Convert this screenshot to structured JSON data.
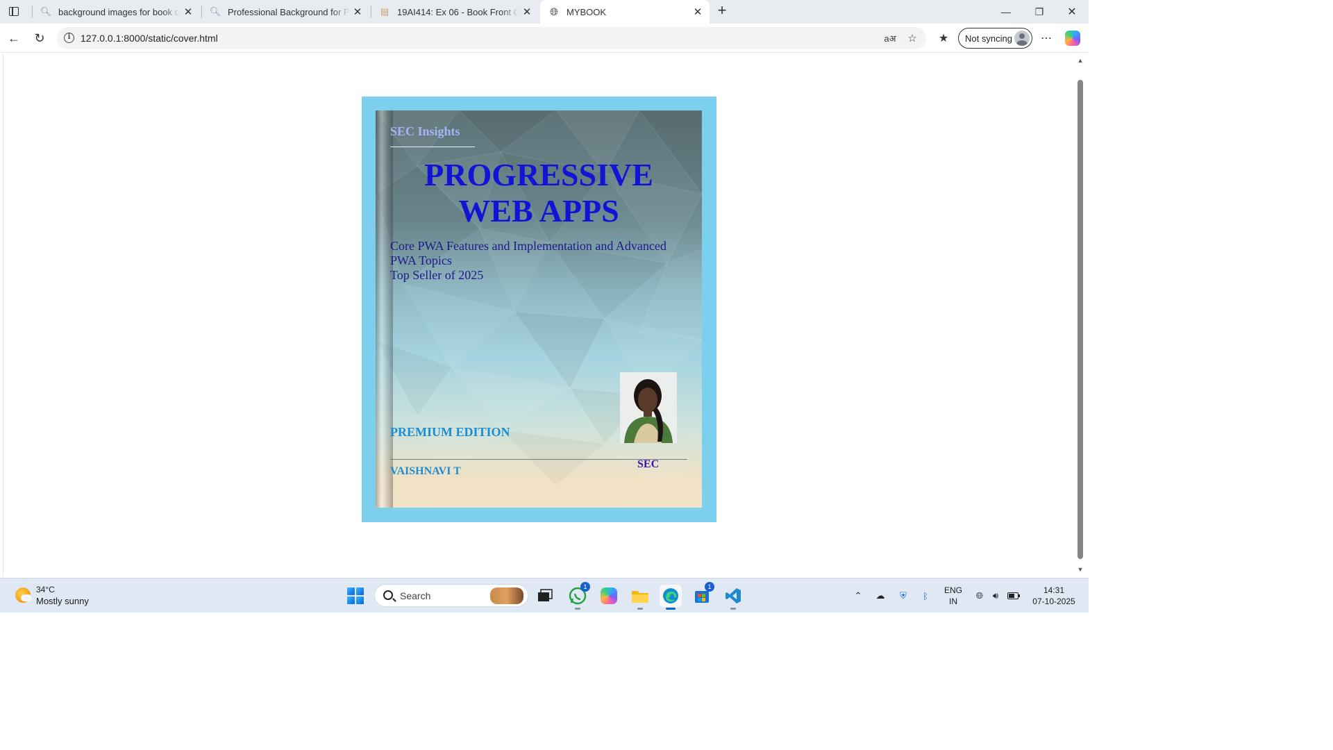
{
  "browser": {
    "tabs": [
      {
        "title": "background images for book cov",
        "icon": "search-icon",
        "active": false
      },
      {
        "title": "Professional Background for Pape",
        "icon": "search-icon",
        "active": false
      },
      {
        "title": "19AI414: Ex 06 - Book Front Cove",
        "icon": "site-favicon",
        "active": false
      },
      {
        "title": "MYBOOK",
        "icon": "globe-icon",
        "active": true
      }
    ],
    "url": "127.0.0.1:8000/static/cover.html",
    "profile_label": "Not syncing"
  },
  "book": {
    "imprint": "SEC Insights",
    "title_line1": "PROGRESSIVE",
    "title_line2": "WEB APPS",
    "subtitle_line1": "Core PWA Features and Implementation and Advanced",
    "subtitle_line2": "PWA Topics",
    "subtitle_line3": "Top Seller of 2025",
    "edition": "PREMIUM EDITION",
    "author": "VAISHNAVI T",
    "publisher": "SEC",
    "colors": {
      "frame": "#7dcfee",
      "title": "#1313d6",
      "subtitle": "#1f1a8a",
      "edition": "#1e8cd0",
      "publisher": "#3a10b0",
      "imprint": "#a4b4f4"
    }
  },
  "taskbar": {
    "temperature": "34°C",
    "weather": "Mostly sunny",
    "search_label": "Search",
    "whatsapp_badge": "1",
    "store_badge": "1",
    "lang_line1": "ENG",
    "lang_line2": "IN",
    "time": "14:31",
    "date": "07-10-2025"
  }
}
